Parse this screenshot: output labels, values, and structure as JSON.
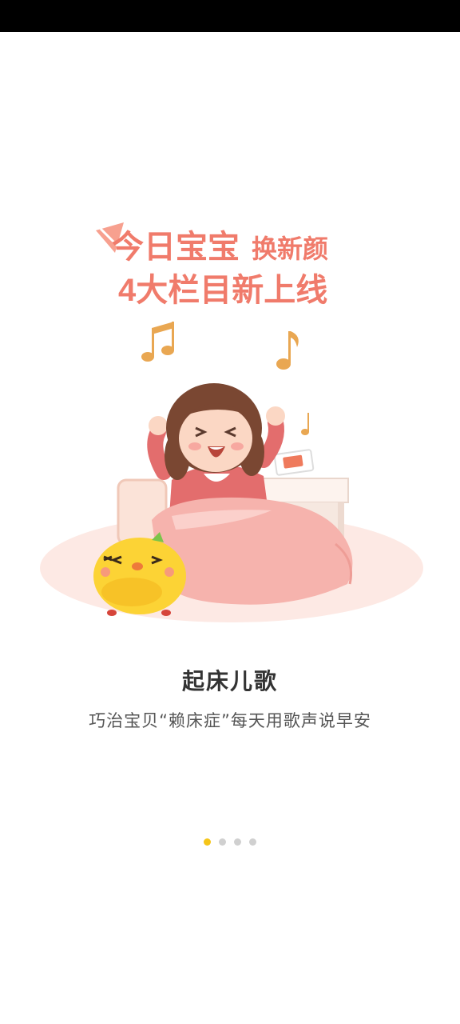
{
  "banner": {
    "line1": "今日宝宝",
    "line1b": "换新颜",
    "line2": "4大栏目新上线"
  },
  "slide": {
    "title": "起床儿歌",
    "subtitle": "巧治宝贝“赖床症”每天用歌声说早安"
  },
  "pager": {
    "count": 4,
    "active_index": 0
  },
  "colors": {
    "status_bar": "#000000",
    "banner_text": "#f07b6b",
    "dot_active": "#f5c518",
    "dot_inactive": "#d0d0d0"
  },
  "icons": [
    "music-note-icon",
    "chick-icon",
    "bed-icon",
    "phone-icon"
  ]
}
